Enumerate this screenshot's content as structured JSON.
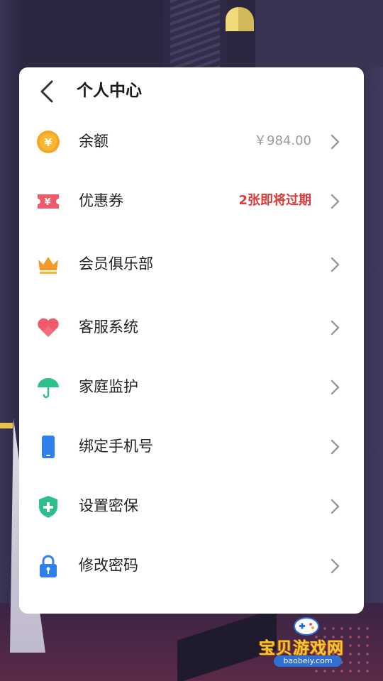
{
  "header": {
    "title": "个人中心"
  },
  "menu": [
    {
      "id": "balance",
      "label": "余额",
      "value": "￥984.00",
      "value_style": "muted",
      "icon": "coin-icon"
    },
    {
      "id": "coupon",
      "label": "优惠券",
      "value": "2张即将过期",
      "value_style": "warn",
      "icon": "ticket-icon"
    },
    {
      "id": "vip",
      "label": "会员俱乐部",
      "value": "",
      "value_style": "muted",
      "icon": "crown-icon"
    },
    {
      "id": "service",
      "label": "客服系统",
      "value": "",
      "value_style": "muted",
      "icon": "heart-icon"
    },
    {
      "id": "family",
      "label": "家庭监护",
      "value": "",
      "value_style": "muted",
      "icon": "umbrella-icon"
    },
    {
      "id": "phone",
      "label": "绑定手机号",
      "value": "",
      "value_style": "muted",
      "icon": "phone-icon"
    },
    {
      "id": "security",
      "label": "设置密保",
      "value": "",
      "value_style": "muted",
      "icon": "shield-icon"
    },
    {
      "id": "password",
      "label": "修改密码",
      "value": "",
      "value_style": "muted",
      "icon": "lock-icon"
    }
  ],
  "colors": {
    "accent_warn": "#d93a3a",
    "coin": "#f5a623",
    "ticket": "#ef5a6a",
    "crown": "#f29b2b",
    "heart": "#ef5a6a",
    "umbrella": "#2bbf8a",
    "phone": "#2f80ed",
    "shield": "#2bbf8a",
    "lock": "#2f80ed"
  },
  "watermark": {
    "brand": "宝贝游戏网",
    "url": "baobeiy.com"
  }
}
